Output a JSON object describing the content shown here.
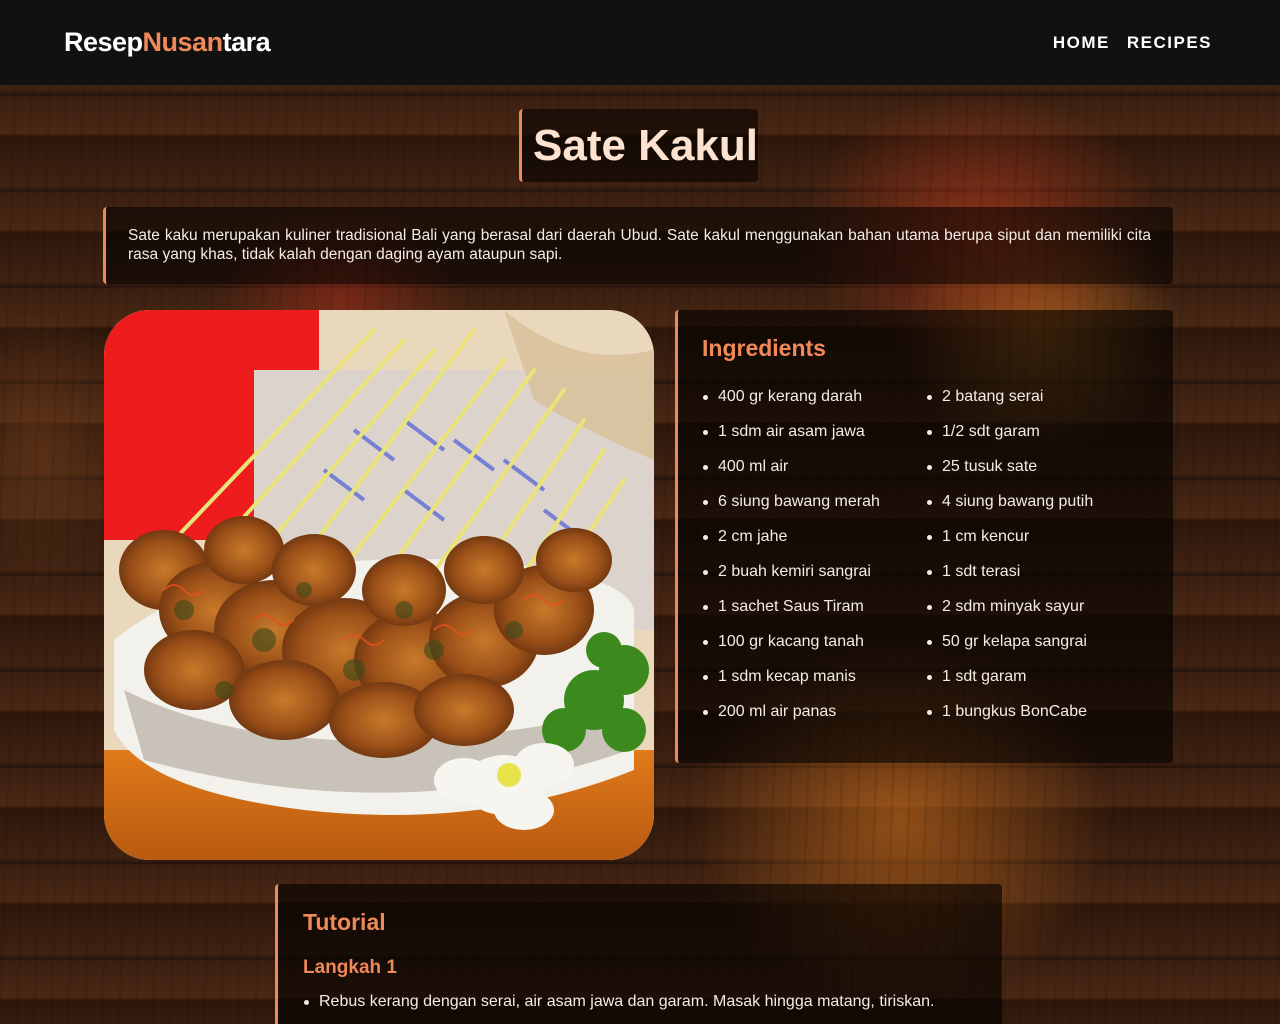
{
  "nav": {
    "brand_part1": "Resep",
    "brand_part2": "Nusan",
    "brand_part3": "tara",
    "links": [
      "HOME",
      "RECIPES"
    ]
  },
  "recipe": {
    "title": "Sate Kakul",
    "description": "Sate kaku merupakan kuliner tradisional Bali yang berasal dari daerah Ubud. Sate kakul menggunakan bahan utama berupa siput dan memiliki cita rasa yang khas, tidak kalah dengan daging ayam ataupun sapi.",
    "image_alt": "sate-kakul-photo"
  },
  "ingredients": {
    "heading": "Ingredients",
    "items": [
      "400 gr kerang darah",
      "1 sdm air asam jawa",
      "400 ml air",
      "6 siung bawang merah",
      "2 cm jahe",
      "2 buah kemiri sangrai",
      "1 sachet Saus Tiram",
      "100 gr kacang tanah",
      "1 sdm kecap manis",
      "200 ml air panas",
      "2 batang serai",
      "1/2 sdt garam",
      "25 tusuk sate",
      "4 siung bawang putih",
      "1 cm kencur",
      "1 sdt terasi",
      "2 sdm minyak sayur",
      "50 gr kelapa sangrai",
      "1 sdt garam",
      "1 bungkus BonCabe"
    ]
  },
  "tutorial": {
    "heading": "Tutorial",
    "steps": [
      {
        "title": "Langkah 1",
        "items": [
          "Rebus kerang dengan serai, air asam jawa dan garam. Masak hingga matang, tiriskan."
        ]
      }
    ]
  },
  "colors": {
    "accent": "#f0895a",
    "navbar": "#111111",
    "title_text": "#fde3cf"
  }
}
